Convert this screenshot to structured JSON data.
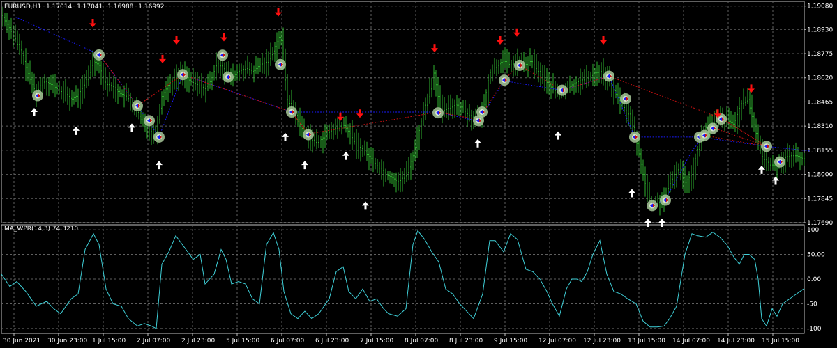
{
  "main": {
    "symbol_label": "EURUSD,H1",
    "ohlc": [
      "1.17014",
      "1.17041",
      "1.16988",
      "1.16992"
    ]
  },
  "sub": {
    "indicator_label": "MA_WPR(14,3) 74.3210"
  },
  "colors": {
    "background": "#000000",
    "grid": "#606060",
    "frame": "#c0c0c0",
    "text": "#ffffff",
    "bull_candle": "#2fb52f",
    "indicator_line": "#3fd0d8",
    "buy_arrow": "#ffffff",
    "sell_arrow": "#ff1010",
    "marker_ring": "#a8c89a",
    "blue_trend": "#1a1aff",
    "red_trend": "#c81010"
  },
  "icons": {
    "buy_signal": "up-arrow-icon",
    "sell_signal": "down-arrow-icon",
    "signal_marker": "circle-marker-icon"
  },
  "chart_data": [
    {
      "type": "candlestick",
      "title": "EURUSD,H1",
      "ylim": [
        1.1769,
        1.1911
      ],
      "y_ticks": [
        "1.19080",
        "1.18930",
        "1.18775",
        "1.18620",
        "1.18465",
        "1.18310",
        "1.18155",
        "1.18000",
        "1.17845",
        "1.17690"
      ],
      "x_ticks": [
        "30 Jun 2021",
        "30 Jun 23:00",
        "1 Jul 15:00",
        "2 Jul 07:00",
        "2 Jul 23:00",
        "5 Jul 15:00",
        "6 Jul 07:00",
        "6 Jul 23:00",
        "7 Jul 15:00",
        "8 Jul 07:00",
        "8 Jul 23:00",
        "9 Jul 15:00",
        "12 Jul 07:00",
        "12 Jul 23:00",
        "13 Jul 15:00",
        "14 Jul 07:00",
        "14 Jul 23:00",
        "15 Jul 15:00"
      ],
      "close_path": [
        [
          0,
          1.1902
        ],
        [
          10,
          1.1895
        ],
        [
          20,
          1.1887
        ],
        [
          30,
          1.1875
        ],
        [
          40,
          1.1862
        ],
        [
          50,
          1.1852
        ],
        [
          60,
          1.186
        ],
        [
          70,
          1.1858
        ],
        [
          80,
          1.1855
        ],
        [
          90,
          1.1852
        ],
        [
          100,
          1.1848
        ],
        [
          110,
          1.1851
        ],
        [
          120,
          1.1858
        ],
        [
          130,
          1.1873
        ],
        [
          140,
          1.187
        ],
        [
          150,
          1.1858
        ],
        [
          160,
          1.1856
        ],
        [
          170,
          1.1852
        ],
        [
          180,
          1.185
        ],
        [
          190,
          1.1843
        ],
        [
          200,
          1.1835
        ],
        [
          210,
          1.183
        ],
        [
          220,
          1.1825
        ],
        [
          230,
          1.185
        ],
        [
          240,
          1.1858
        ],
        [
          250,
          1.1862
        ],
        [
          260,
          1.1865
        ],
        [
          270,
          1.186
        ],
        [
          280,
          1.1858
        ],
        [
          290,
          1.1855
        ],
        [
          300,
          1.186
        ],
        [
          310,
          1.1872
        ],
        [
          320,
          1.1866
        ],
        [
          330,
          1.1862
        ],
        [
          340,
          1.1866
        ],
        [
          350,
          1.1868
        ],
        [
          360,
          1.1866
        ],
        [
          370,
          1.187
        ],
        [
          380,
          1.1872
        ],
        [
          390,
          1.188
        ],
        [
          400,
          1.189
        ],
        [
          410,
          1.1848
        ],
        [
          420,
          1.184
        ],
        [
          430,
          1.183
        ],
        [
          440,
          1.1825
        ],
        [
          450,
          1.182
        ],
        [
          460,
          1.1823
        ],
        [
          470,
          1.1827
        ],
        [
          480,
          1.183
        ],
        [
          490,
          1.1832
        ],
        [
          500,
          1.1826
        ],
        [
          510,
          1.1818
        ],
        [
          520,
          1.1815
        ],
        [
          530,
          1.181
        ],
        [
          540,
          1.1805
        ],
        [
          550,
          1.18
        ],
        [
          560,
          1.1798
        ],
        [
          570,
          1.1795
        ],
        [
          580,
          1.18
        ],
        [
          590,
          1.1812
        ],
        [
          600,
          1.183
        ],
        [
          610,
          1.1848
        ],
        [
          620,
          1.1865
        ],
        [
          630,
          1.184
        ],
        [
          640,
          1.1842
        ],
        [
          650,
          1.1845
        ],
        [
          660,
          1.1843
        ],
        [
          670,
          1.1838
        ],
        [
          680,
          1.1835
        ],
        [
          690,
          1.184
        ],
        [
          700,
          1.1865
        ],
        [
          710,
          1.187
        ],
        [
          720,
          1.1873
        ],
        [
          730,
          1.187
        ],
        [
          740,
          1.1872
        ],
        [
          750,
          1.187
        ],
        [
          760,
          1.1873
        ],
        [
          770,
          1.1866
        ],
        [
          780,
          1.186
        ],
        [
          790,
          1.1855
        ],
        [
          800,
          1.1852
        ],
        [
          810,
          1.1855
        ],
        [
          820,
          1.1858
        ],
        [
          830,
          1.186
        ],
        [
          840,
          1.1862
        ],
        [
          850,
          1.1865
        ],
        [
          860,
          1.1866
        ],
        [
          870,
          1.186
        ],
        [
          880,
          1.1852
        ],
        [
          890,
          1.1845
        ],
        [
          900,
          1.1838
        ],
        [
          910,
          1.1822
        ],
        [
          920,
          1.18
        ],
        [
          930,
          1.178
        ],
        [
          940,
          1.1782
        ],
        [
          950,
          1.1785
        ],
        [
          960,
          1.1795
        ],
        [
          970,
          1.1805
        ],
        [
          980,
          1.1795
        ],
        [
          990,
          1.18
        ],
        [
          1000,
          1.182
        ],
        [
          1010,
          1.183
        ],
        [
          1020,
          1.1832
        ],
        [
          1030,
          1.1836
        ],
        [
          1040,
          1.1835
        ],
        [
          1050,
          1.1832
        ],
        [
          1060,
          1.1845
        ],
        [
          1070,
          1.1848
        ],
        [
          1080,
          1.183
        ],
        [
          1090,
          1.1812
        ],
        [
          1100,
          1.1806
        ],
        [
          1110,
          1.1806
        ],
        [
          1120,
          1.181
        ],
        [
          1130,
          1.1812
        ],
        [
          1140,
          1.1812
        ],
        [
          1150,
          1.181
        ]
      ],
      "buy_signals": [
        [
          47,
          1.184
        ],
        [
          107,
          1.1828
        ],
        [
          187,
          1.183
        ],
        [
          226,
          1.1806
        ],
        [
          407,
          1.1824
        ],
        [
          435,
          1.1806
        ],
        [
          494,
          1.1812
        ],
        [
          522,
          1.178
        ],
        [
          683,
          1.182
        ],
        [
          798,
          1.1825
        ],
        [
          904,
          1.1788
        ],
        [
          927,
          1.1769
        ],
        [
          947,
          1.1769
        ],
        [
          1090,
          1.1803
        ],
        [
          1110,
          1.1796
        ]
      ],
      "sell_signals": [
        [
          131,
          1.1897
        ],
        [
          251,
          1.1886
        ],
        [
          231,
          1.1874
        ],
        [
          319,
          1.1888
        ],
        [
          397,
          1.1904
        ],
        [
          486,
          1.1837
        ],
        [
          514,
          1.1839
        ],
        [
          621,
          1.1881
        ],
        [
          715,
          1.1886
        ],
        [
          739,
          1.1891
        ],
        [
          863,
          1.1886
        ],
        [
          1027,
          1.1839
        ],
        [
          1075,
          1.1855
        ]
      ],
      "markers": [
        [
          52,
          1.18505
        ],
        [
          140,
          1.18767
        ],
        [
          195,
          1.1844
        ],
        [
          212,
          1.18345
        ],
        [
          226,
          1.1824
        ],
        [
          260,
          1.1864
        ],
        [
          317,
          1.18765
        ],
        [
          325,
          1.18625
        ],
        [
          400,
          1.18705
        ],
        [
          416,
          1.184
        ],
        [
          440,
          1.18255
        ],
        [
          626,
          1.18395
        ],
        [
          684,
          1.18345
        ],
        [
          689,
          1.184
        ],
        [
          721,
          1.18605
        ],
        [
          743,
          1.187
        ],
        [
          804,
          1.1854
        ],
        [
          871,
          1.1863
        ],
        [
          895,
          1.18485
        ],
        [
          908,
          1.1824
        ],
        [
          933,
          1.178
        ],
        [
          952,
          1.17835
        ],
        [
          1001,
          1.1824
        ],
        [
          1008,
          1.1825
        ],
        [
          1020,
          1.18295
        ],
        [
          1032,
          1.18355
        ],
        [
          1097,
          1.1818
        ],
        [
          1116,
          1.1808
        ]
      ],
      "blue_trend": [
        [
          20,
          1.1901
        ],
        [
          140,
          1.1877
        ],
        [
          195,
          1.1844
        ],
        [
          226,
          1.1824
        ],
        [
          260,
          1.1864
        ],
        [
          416,
          1.184
        ],
        [
          626,
          1.184
        ],
        [
          684,
          1.1834
        ],
        [
          721,
          1.186
        ],
        [
          804,
          1.1854
        ],
        [
          871,
          1.1863
        ],
        [
          908,
          1.1824
        ],
        [
          1001,
          1.1824
        ],
        [
          1097,
          1.1818
        ],
        [
          1160,
          1.1815
        ]
      ],
      "blue_trend_2": [
        [
          933,
          1.178
        ],
        [
          952,
          1.1784
        ],
        [
          990,
          1.1815
        ],
        [
          1008,
          1.1825
        ]
      ],
      "red_trend": [
        [
          140,
          1.1877
        ],
        [
          195,
          1.1844
        ],
        [
          260,
          1.1864
        ],
        [
          416,
          1.184
        ],
        [
          440,
          1.1826
        ],
        [
          626,
          1.184
        ],
        [
          684,
          1.1835
        ],
        [
          721,
          1.1861
        ],
        [
          743,
          1.187
        ],
        [
          804,
          1.1854
        ],
        [
          871,
          1.1863
        ],
        [
          1032,
          1.1836
        ],
        [
          1097,
          1.1818
        ]
      ],
      "red_fan": [
        [
          1008,
          1.1825
        ],
        [
          1097,
          1.1818
        ],
        [
          1020,
          1.183
        ],
        [
          1097,
          1.1818
        ],
        [
          1032,
          1.1836
        ],
        [
          1097,
          1.1818
        ]
      ]
    },
    {
      "type": "line",
      "title": "MA_WPR(14,3) 74.3210",
      "ylim": [
        -110,
        110
      ],
      "y_ticks": [
        "100",
        "-100"
      ],
      "y_ticks_left": [
        "100",
        "50.00",
        "0.00",
        "-50",
        "-100"
      ],
      "x_ticks": [
        "30 Jun 2021",
        "30 Jun 23:00",
        "1 Jul 15:00",
        "2 Jul 07:00",
        "2 Jul 23:00",
        "5 Jul 15:00",
        "6 Jul 07:00",
        "6 Jul 23:00",
        "7 Jul 15:00",
        "8 Jul 07:00",
        "8 Jul 23:00",
        "9 Jul 15:00",
        "12 Jul 07:00",
        "12 Jul 23:00",
        "13 Jul 15:00",
        "14 Jul 07:00",
        "14 Jul 23:00",
        "15 Jul 15:00"
      ],
      "values": [
        [
          0,
          10
        ],
        [
          12,
          -15
        ],
        [
          22,
          -5
        ],
        [
          35,
          -25
        ],
        [
          50,
          -55
        ],
        [
          65,
          -45
        ],
        [
          75,
          -60
        ],
        [
          85,
          -70
        ],
        [
          100,
          -40
        ],
        [
          110,
          -30
        ],
        [
          120,
          60
        ],
        [
          132,
          92
        ],
        [
          140,
          70
        ],
        [
          150,
          -20
        ],
        [
          160,
          -50
        ],
        [
          172,
          -55
        ],
        [
          182,
          -80
        ],
        [
          195,
          -95
        ],
        [
          205,
          -90
        ],
        [
          215,
          -95
        ],
        [
          222,
          -100
        ],
        [
          230,
          30
        ],
        [
          240,
          55
        ],
        [
          250,
          88
        ],
        [
          262,
          65
        ],
        [
          275,
          40
        ],
        [
          285,
          50
        ],
        [
          292,
          -10
        ],
        [
          305,
          10
        ],
        [
          315,
          60
        ],
        [
          322,
          40
        ],
        [
          330,
          -10
        ],
        [
          340,
          -5
        ],
        [
          350,
          -10
        ],
        [
          360,
          -40
        ],
        [
          370,
          -50
        ],
        [
          380,
          70
        ],
        [
          390,
          94
        ],
        [
          398,
          60
        ],
        [
          405,
          -25
        ],
        [
          415,
          -70
        ],
        [
          425,
          -80
        ],
        [
          435,
          -65
        ],
        [
          445,
          -80
        ],
        [
          455,
          -70
        ],
        [
          470,
          -40
        ],
        [
          480,
          15
        ],
        [
          490,
          25
        ],
        [
          498,
          -25
        ],
        [
          508,
          -40
        ],
        [
          518,
          -20
        ],
        [
          528,
          -45
        ],
        [
          538,
          -40
        ],
        [
          548,
          -60
        ],
        [
          555,
          -70
        ],
        [
          568,
          -75
        ],
        [
          580,
          -60
        ],
        [
          590,
          70
        ],
        [
          597,
          98
        ],
        [
          607,
          80
        ],
        [
          617,
          55
        ],
        [
          627,
          35
        ],
        [
          637,
          -20
        ],
        [
          647,
          -30
        ],
        [
          657,
          -50
        ],
        [
          667,
          -65
        ],
        [
          677,
          -80
        ],
        [
          690,
          -30
        ],
        [
          700,
          78
        ],
        [
          708,
          78
        ],
        [
          720,
          55
        ],
        [
          730,
          92
        ],
        [
          740,
          80
        ],
        [
          752,
          20
        ],
        [
          762,
          15
        ],
        [
          772,
          0
        ],
        [
          782,
          -25
        ],
        [
          790,
          -50
        ],
        [
          800,
          -75
        ],
        [
          810,
          -20
        ],
        [
          818,
          0
        ],
        [
          825,
          0
        ],
        [
          832,
          -5
        ],
        [
          840,
          15
        ],
        [
          848,
          50
        ],
        [
          858,
          78
        ],
        [
          868,
          10
        ],
        [
          878,
          -25
        ],
        [
          888,
          -30
        ],
        [
          898,
          -40
        ],
        [
          910,
          -50
        ],
        [
          920,
          -85
        ],
        [
          930,
          -97
        ],
        [
          940,
          -97
        ],
        [
          950,
          -95
        ],
        [
          958,
          -80
        ],
        [
          968,
          -55
        ],
        [
          980,
          50
        ],
        [
          990,
          92
        ],
        [
          998,
          88
        ],
        [
          1010,
          85
        ],
        [
          1020,
          95
        ],
        [
          1030,
          85
        ],
        [
          1040,
          70
        ],
        [
          1050,
          45
        ],
        [
          1058,
          30
        ],
        [
          1065,
          50
        ],
        [
          1072,
          50
        ],
        [
          1080,
          40
        ],
        [
          1085,
          0
        ],
        [
          1090,
          -80
        ],
        [
          1097,
          -95
        ],
        [
          1105,
          -60
        ],
        [
          1112,
          -75
        ],
        [
          1120,
          -50
        ],
        [
          1130,
          -40
        ],
        [
          1140,
          -30
        ],
        [
          1150,
          -20
        ]
      ]
    }
  ]
}
